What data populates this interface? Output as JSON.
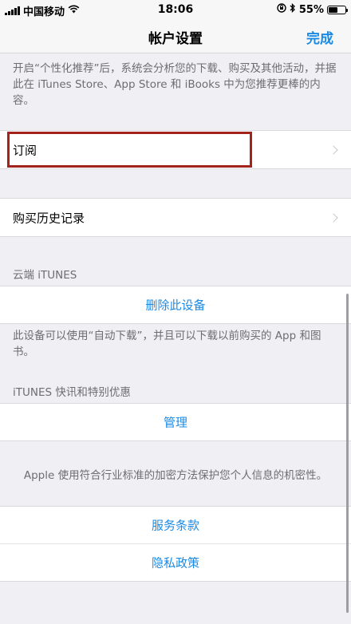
{
  "status_bar": {
    "carrier": "中国移动",
    "time": "18:06",
    "battery": "55%",
    "battery_level": 0.55
  },
  "nav": {
    "title": "帐户设置",
    "done_label": "完成"
  },
  "personalization_note": "开启“个性化推荐”后，系统会分析您的下载、购买及其他活动，并据此在 iTunes Store、App Store 和 iBooks 中为您推荐更棒的内容。",
  "subscriptions": {
    "label": "订阅"
  },
  "purchase_history": {
    "label": "购买历史记录"
  },
  "cloud": {
    "header": "云端 iTUNES",
    "remove_device_label": "删除此设备",
    "note": "此设备可以使用“自动下载”，并且可以下载以前购买的 App 和图书。"
  },
  "newsletter": {
    "header": "iTUNES 快讯和特别优惠",
    "manage_label": "管理"
  },
  "privacy": {
    "note": "Apple 使用符合行业标准的加密方法保护您个人信息的机密性。",
    "terms_label": "服务条款",
    "policy_label": "隐私政策"
  },
  "colors": {
    "accent": "#1a8ae5",
    "highlight_border": "#a3221b",
    "background": "#efeff4"
  }
}
